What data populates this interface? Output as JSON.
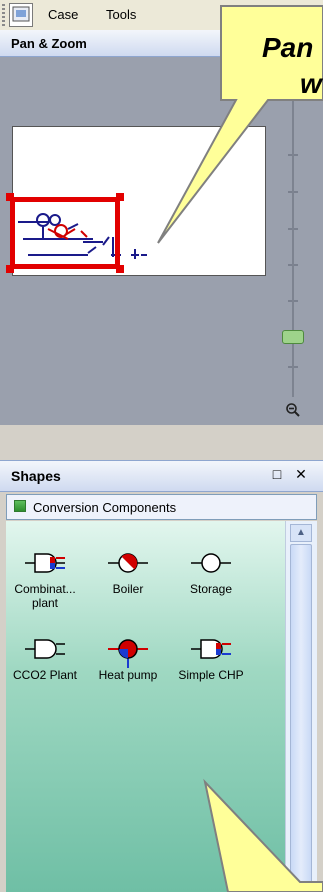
{
  "menubar": {
    "items": [
      "Case",
      "Tools"
    ]
  },
  "pan_zoom": {
    "title": "Pan & Zoom",
    "zoom_level": 0.43
  },
  "shapes": {
    "title": "Shapes",
    "stencil": "Conversion Components",
    "items": [
      {
        "label": "Combinat... plant",
        "icon": "combination-plant-icon"
      },
      {
        "label": "Boiler",
        "icon": "boiler-icon"
      },
      {
        "label": "Storage",
        "icon": "storage-icon"
      },
      {
        "label": "CCO2 Plant",
        "icon": "cco2-plant-icon"
      },
      {
        "label": "Heat pump",
        "icon": "heat-pump-icon"
      },
      {
        "label": "Simple CHP",
        "icon": "simple-chp-icon"
      }
    ]
  },
  "callout": {
    "line1": "Pan",
    "line2": "w"
  },
  "colors": {
    "viewport": "#e20000",
    "callout_fill": "#ffff99",
    "shape_area": "#9fd8c2"
  }
}
